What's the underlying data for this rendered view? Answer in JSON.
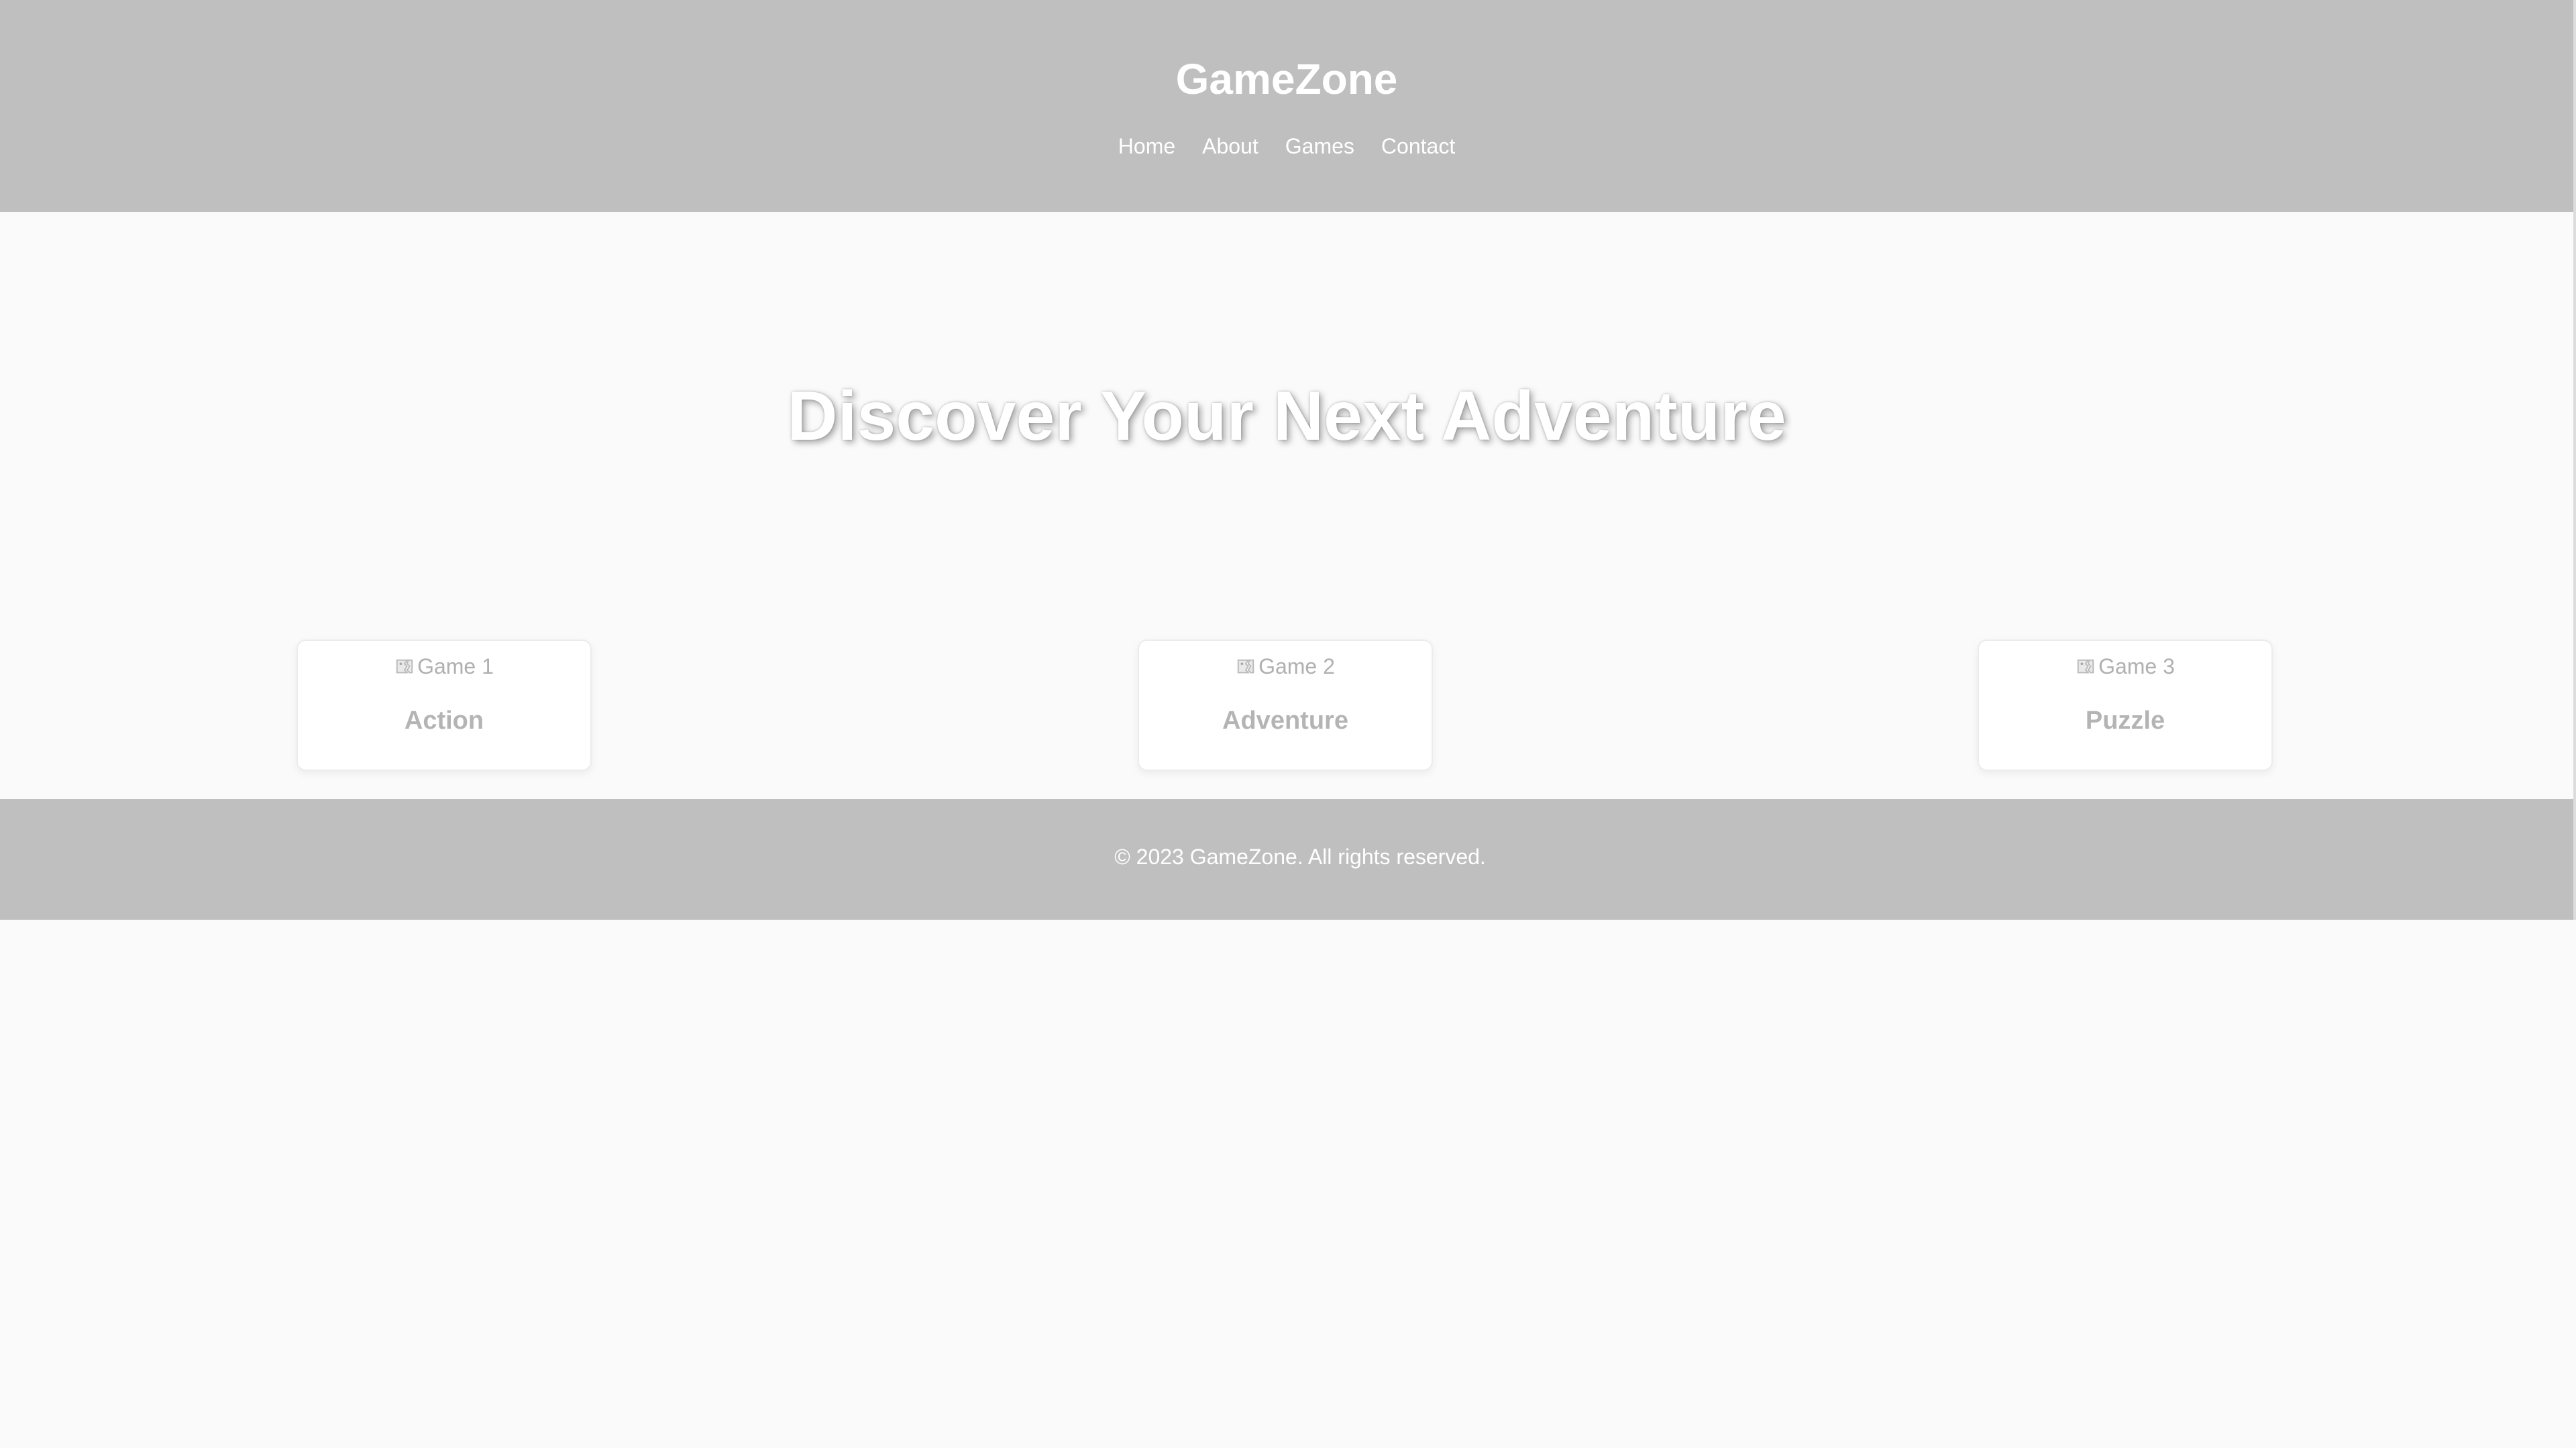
{
  "header": {
    "title": "GameZone",
    "nav": [
      "Home",
      "About",
      "Games",
      "Contact"
    ]
  },
  "hero": {
    "heading": "Discover Your Next Adventure"
  },
  "games": [
    {
      "image_alt": "Game 1",
      "genre": "Action"
    },
    {
      "image_alt": "Game 2",
      "genre": "Adventure"
    },
    {
      "image_alt": "Game 3",
      "genre": "Puzzle"
    }
  ],
  "footer": {
    "copyright": "© 2023 GameZone. All rights reserved."
  },
  "icons": {
    "broken_image": "broken-image-icon"
  },
  "colors": {
    "header_bg": "#bfbfbf",
    "page_bg": "#fafafa",
    "header_text": "#ffffff",
    "card_text": "#b4b4b4"
  }
}
